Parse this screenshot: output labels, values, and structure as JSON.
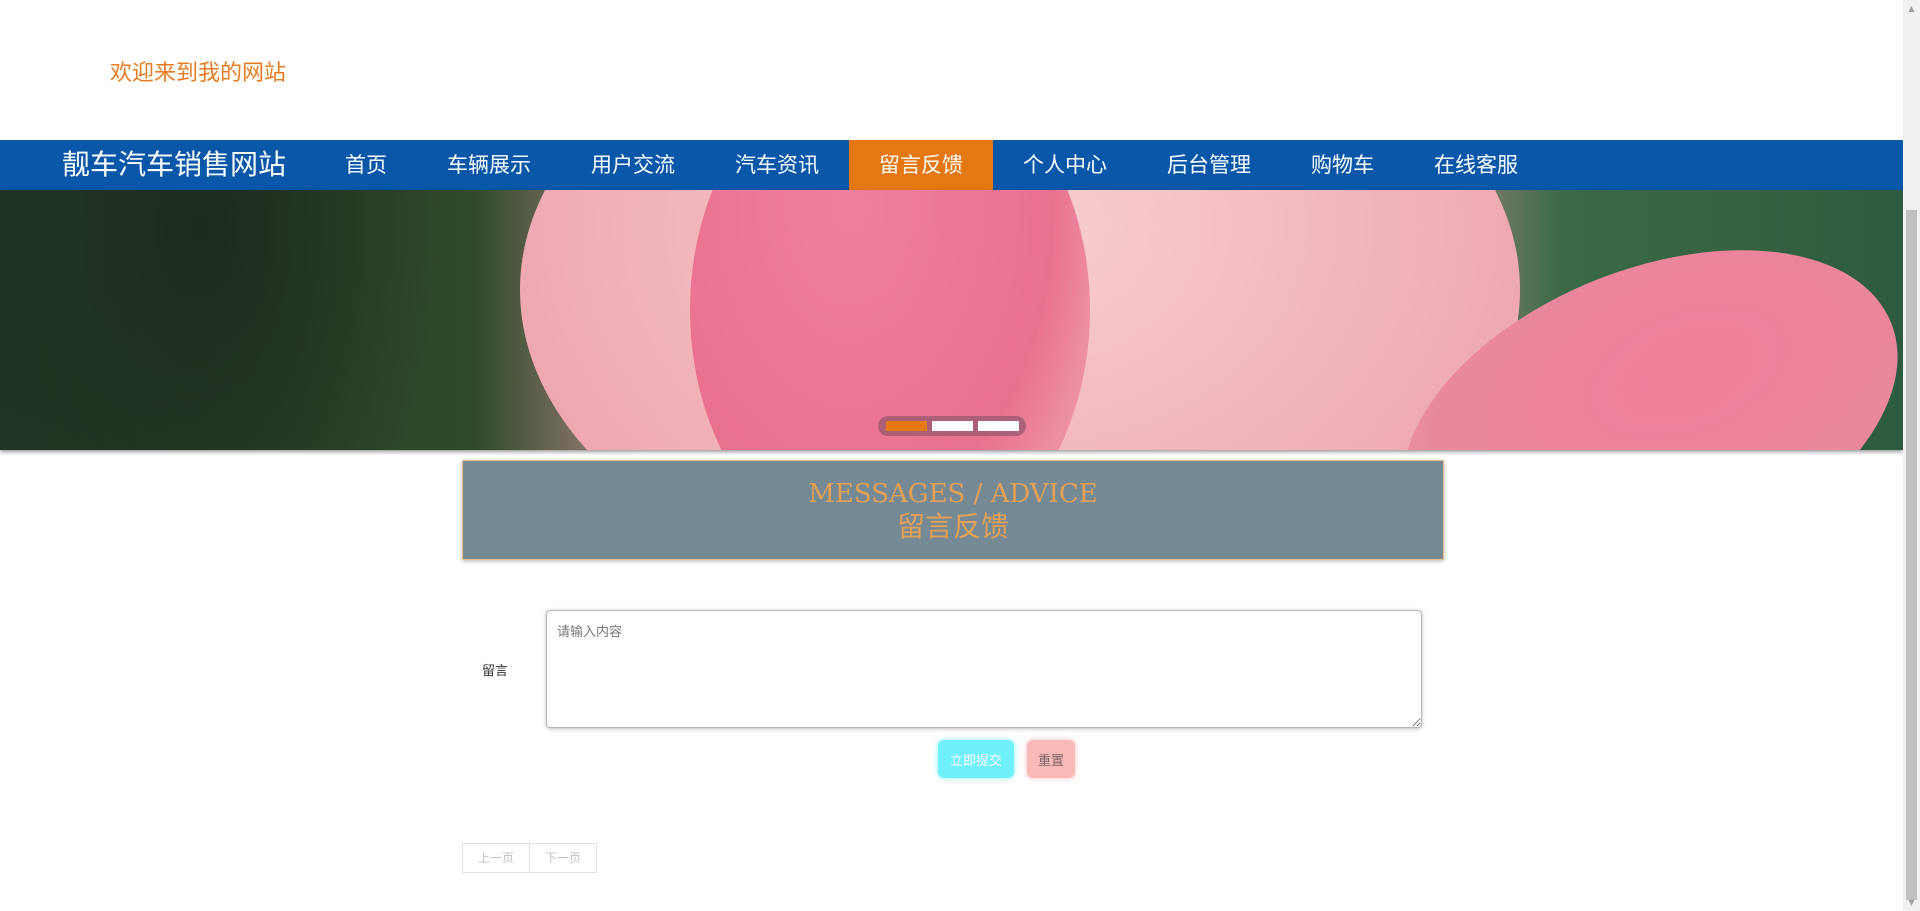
{
  "header": {
    "welcome": "欢迎来到我的网站"
  },
  "navbar": {
    "brand": "靓车汽车销售网站",
    "items": [
      {
        "label": "首页"
      },
      {
        "label": "车辆展示"
      },
      {
        "label": "用户交流"
      },
      {
        "label": "汽车资讯"
      },
      {
        "label": "留言反馈",
        "active": true
      },
      {
        "label": "个人中心"
      },
      {
        "label": "后台管理"
      },
      {
        "label": "购物车"
      },
      {
        "label": "在线客服"
      }
    ],
    "colors": {
      "bar": "#0857a9",
      "active": "#e57813"
    }
  },
  "banner": {
    "slides": 3,
    "active_slide": 1
  },
  "section": {
    "title_en": "MESSAGES / ADVICE",
    "title_cn": "留言反馈"
  },
  "form": {
    "label": "留言",
    "placeholder": "请输入内容",
    "value": "",
    "submit_label": "立即提交",
    "reset_label": "重置"
  },
  "pager": {
    "prev_label": "上一页",
    "next_label": "下一页"
  }
}
